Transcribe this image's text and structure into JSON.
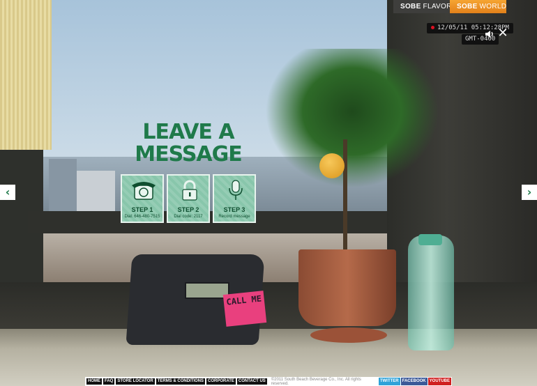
{
  "topnav": {
    "flavors": {
      "brand": "SOBE",
      "label": "FLAVORS"
    },
    "world": {
      "brand": "SOBE",
      "label": "WORLD"
    }
  },
  "clock": {
    "datetime": "12/05/11 05:12:28PM",
    "timezone": "GMT-0400"
  },
  "hero": {
    "title_line1": "LEAVE A",
    "title_line2": "MESSAGE"
  },
  "steps": [
    {
      "label": "STEP 1",
      "desc": "Dial: 646-480-7515",
      "icon": "telephone-icon"
    },
    {
      "label": "STEP 2",
      "desc": "Dial code: 2117",
      "icon": "lock-icon"
    },
    {
      "label": "STEP 3",
      "desc": "Record message",
      "icon": "microphone-icon"
    }
  ],
  "sticky_note": "CALL ME",
  "nav_arrows": {
    "left": "‹",
    "right": "›"
  },
  "close_glyph": "✕",
  "footer": {
    "links": [
      "HOME",
      "FAQ",
      "STORE LOCATOR",
      "TERMS & CONDITIONS",
      "CORPORATE",
      "CONTACT US"
    ],
    "copyright": "©2011 South Beach Beverage Co., Inc. All rights reserved.",
    "social": [
      "TWITTER",
      "FACEBOOK",
      "YOUTUBE"
    ]
  },
  "colors": {
    "brand_green": "#1f7a4a",
    "step_green": "#88c6ab",
    "world_orange": "#f6a532"
  }
}
